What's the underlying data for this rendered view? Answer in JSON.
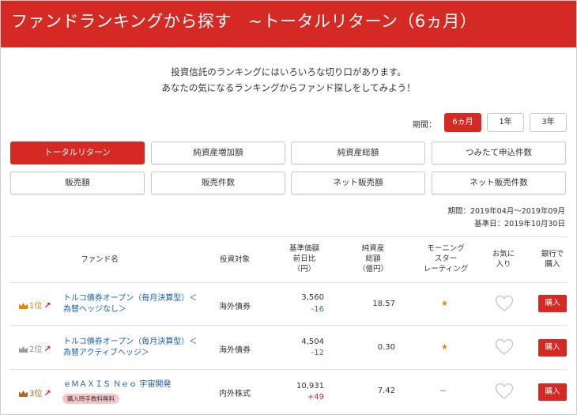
{
  "header": {
    "title": "ファンドランキングから探す　~トータルリターン（6ヵ月）"
  },
  "intro": {
    "line1": "投資信託のランキングにはいろいろな切り口があります。",
    "line2": "あなたの気になるランキングからファンド探しをしてみよう！"
  },
  "period": {
    "label": "期間：",
    "options": [
      "6ヵ月",
      "1年",
      "3年"
    ],
    "selected": "6ヵ月"
  },
  "categories": [
    "トータルリターン",
    "純資産増加額",
    "純資産総額",
    "つみたて申込件数",
    "販売額",
    "販売件数",
    "ネット販売額",
    "ネット販売件数"
  ],
  "active_category": "トータルリターン",
  "meta": {
    "period_text": "期間：2019年04月～2019年09月",
    "base_date": "基準日：2019年10月30日"
  },
  "columns": {
    "fund_name": "ファンド名",
    "target": "投資対象",
    "price": [
      "基準価額",
      "前日比",
      "（円）"
    ],
    "assets": [
      "純資産",
      "総額",
      "（億円）"
    ],
    "morningstar": [
      "モーニング",
      "スター",
      "レーティング"
    ],
    "favorite": [
      "お気に",
      "入り"
    ],
    "buy": [
      "銀行で",
      "購入"
    ]
  },
  "rows": [
    {
      "rank": "1位",
      "name_line1": "トルコ債券オープン（毎月決算型）＜",
      "name_line2": "為替ヘッジなし＞",
      "tag": "",
      "target": "海外債券",
      "price": "3,560",
      "change": "-16",
      "assets": "18.57",
      "rating": "★",
      "buy_label": "購入"
    },
    {
      "rank": "2位",
      "name_line1": "トルコ債券オープン（毎月決算型）＜",
      "name_line2": "為替アクティブヘッジ＞",
      "tag": "",
      "target": "海外債券",
      "price": "4,504",
      "change": "-12",
      "assets": "0.30",
      "rating": "★",
      "buy_label": "購入"
    },
    {
      "rank": "3位",
      "name_line1": "ｅＭＡＸＩＳ Ｎｅｏ 宇宙開発",
      "name_line2": "",
      "tag": "購入時手数料無料",
      "target": "内外株式",
      "price": "10,931",
      "change": "+49",
      "assets": "7.42",
      "rating": "--",
      "buy_label": "購入"
    }
  ],
  "colors": {
    "accent": "#d42a23",
    "link": "#1a5fb4",
    "gold": "#e08a00",
    "negative": "#2e8b2e"
  }
}
